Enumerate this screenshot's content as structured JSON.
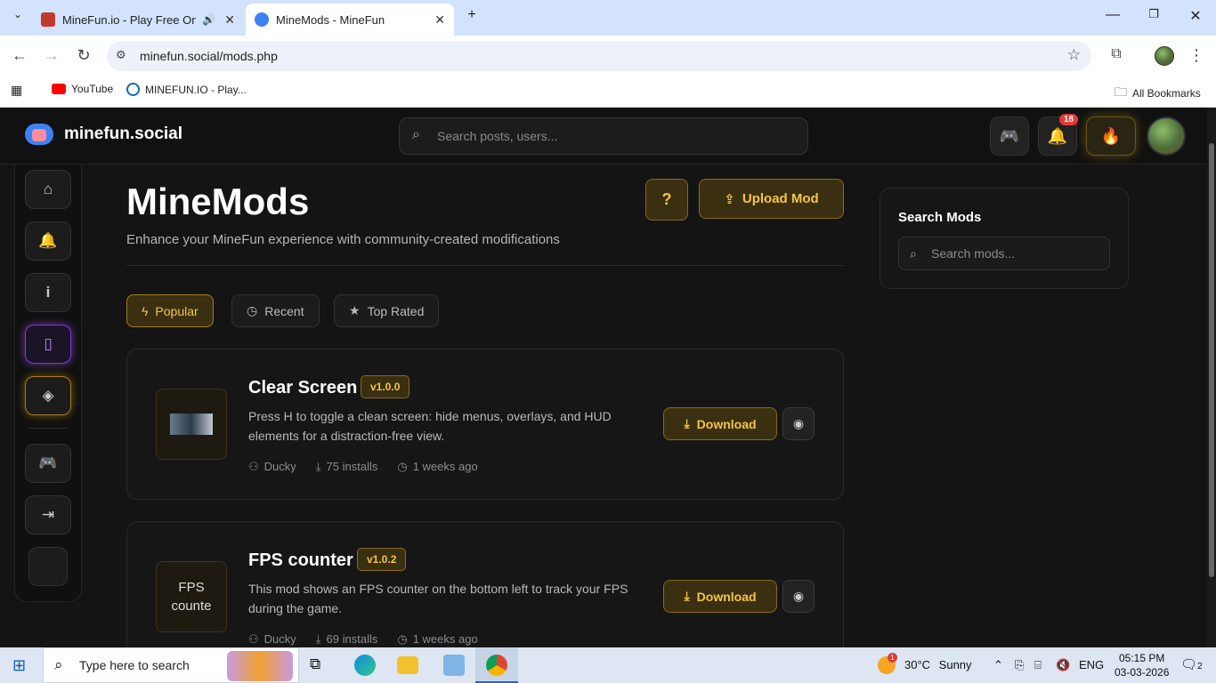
{
  "browser": {
    "tabs": [
      {
        "title": "MineFun.io - Play Free Online",
        "active": false
      },
      {
        "title": "MineMods - MineFun",
        "active": true
      }
    ],
    "url": "minefun.social/mods.php",
    "bookmarks": [
      {
        "label": "YouTube"
      },
      {
        "label": "MINEFUN.IO - Play..."
      }
    ],
    "all_bookmarks": "All Bookmarks"
  },
  "site": {
    "brand": "minefun.social",
    "search_placeholder": "Search posts, users...",
    "notifications_count": "18"
  },
  "page": {
    "title": "MineMods",
    "subtitle": "Enhance your MineFun experience with community-created modifications",
    "upload_label": "Upload Mod",
    "filters": [
      {
        "label": "Popular",
        "active": true
      },
      {
        "label": "Recent",
        "active": false
      },
      {
        "label": "Top Rated",
        "active": false
      }
    ]
  },
  "mods": [
    {
      "name": "Clear Screen",
      "version": "v1.0.0",
      "description": "Press H to toggle a clean screen: hide menus, overlays, and HUD elements for a distraction-free view.",
      "author": "Ducky",
      "installs": "75 installs",
      "age": "1 weeks ago",
      "download_label": "Download",
      "thumb_alt": ""
    },
    {
      "name": "FPS counter",
      "version": "v1.0.2",
      "description": "This mod shows an FPS counter on the bottom left to track your FPS during the game.",
      "author": "Ducky",
      "installs": "69 installs",
      "age": "1 weeks ago",
      "download_label": "Download",
      "thumb_alt": "FPS counte"
    }
  ],
  "search_panel": {
    "title": "Search Mods",
    "placeholder": "Search mods..."
  },
  "taskbar": {
    "search_placeholder": "Type here to search",
    "weather_temp": "30°C",
    "weather_text": "Sunny",
    "weather_badge": "1",
    "language": "ENG",
    "time": "05:15 PM",
    "date": "03-03-2026",
    "notif_count": "2"
  }
}
